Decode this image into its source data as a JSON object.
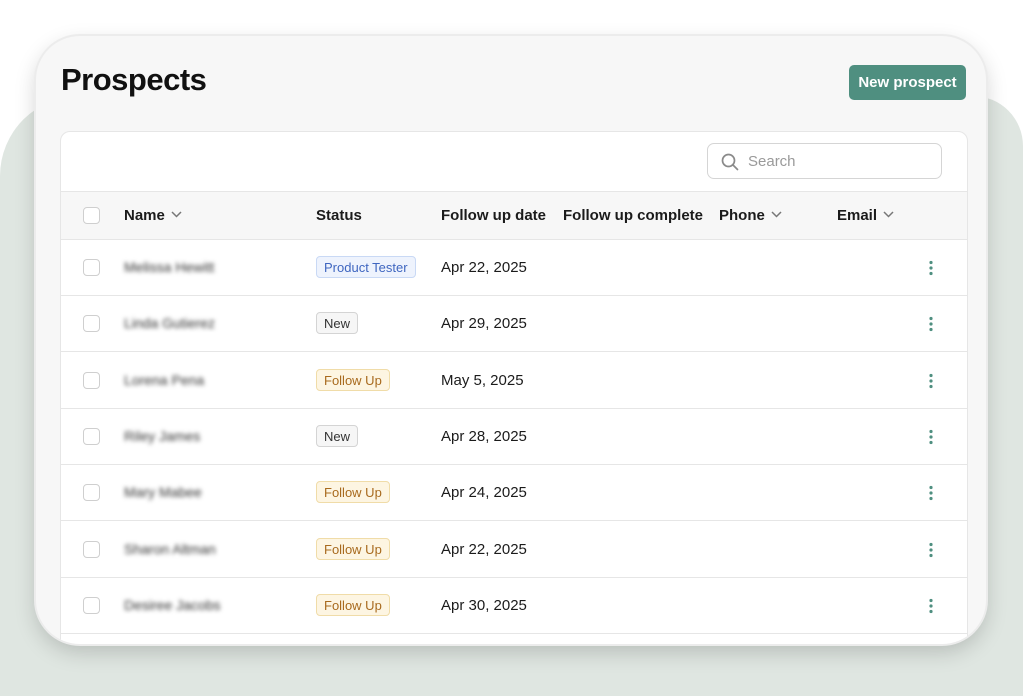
{
  "page": {
    "title": "Prospects"
  },
  "toolbar": {
    "new_label": "New prospect"
  },
  "search": {
    "placeholder": "Search",
    "value": ""
  },
  "table": {
    "columns": [
      {
        "key": "name",
        "label": "Name",
        "sortable": true
      },
      {
        "key": "status",
        "label": "Status",
        "sortable": false
      },
      {
        "key": "follow_up_date",
        "label": "Follow up date",
        "sortable": false
      },
      {
        "key": "follow_up_complete",
        "label": "Follow up complete",
        "sortable": false
      },
      {
        "key": "phone",
        "label": "Phone",
        "sortable": true
      },
      {
        "key": "email",
        "label": "Email",
        "sortable": true
      }
    ],
    "rows": [
      {
        "name": "Melissa Hewitt",
        "status": "Product Tester",
        "status_kind": "tester",
        "follow_up_date": "Apr 22, 2025"
      },
      {
        "name": "Linda Gutierez",
        "status": "New",
        "status_kind": "new",
        "follow_up_date": "Apr 29, 2025"
      },
      {
        "name": "Lorena Pena",
        "status": "Follow Up",
        "status_kind": "follow",
        "follow_up_date": "May 5, 2025"
      },
      {
        "name": "Riley James",
        "status": "New",
        "status_kind": "new",
        "follow_up_date": "Apr 28, 2025"
      },
      {
        "name": "Mary Mabee",
        "status": "Follow Up",
        "status_kind": "follow",
        "follow_up_date": "Apr 24, 2025"
      },
      {
        "name": "Sharon Altman",
        "status": "Follow Up",
        "status_kind": "follow",
        "follow_up_date": "Apr 22, 2025"
      },
      {
        "name": "Desiree Jacobs",
        "status": "Follow Up",
        "status_kind": "follow",
        "follow_up_date": "Apr 30, 2025"
      }
    ]
  },
  "icons": {
    "search": "search-icon",
    "sort": "chevron-down-icon",
    "row_menu": "more-vertical-icon"
  },
  "colors": {
    "accent": "#4f8f80",
    "follow_up": "#a86a1e",
    "product_tester": "#3f66c0"
  }
}
